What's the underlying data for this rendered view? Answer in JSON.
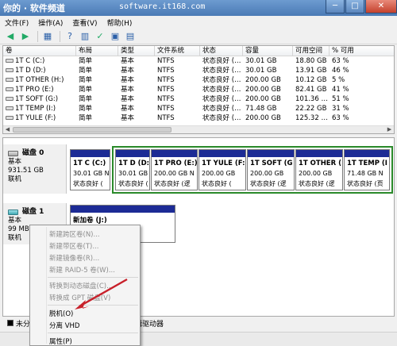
{
  "watermark": {
    "cn": "你的 · 软件频道",
    "url": "software.it168.com"
  },
  "window_buttons": {
    "minimize": "─",
    "maximize": "□",
    "close": "✕"
  },
  "menu": [
    "文件(F)",
    "操作(A)",
    "查看(V)",
    "帮助(H)"
  ],
  "toolbar_icons": [
    "back-arrow-icon",
    "forward-arrow-icon",
    "grid-icon",
    "help-icon",
    "help-book-icon",
    "refresh-icon",
    "properties-icon",
    "view-icon"
  ],
  "table": {
    "columns": [
      "卷",
      "布局",
      "类型",
      "文件系统",
      "状态",
      "容量",
      "可用空间",
      "% 可用"
    ],
    "rows": [
      [
        "1T C (C:)",
        "简单",
        "基本",
        "NTFS",
        "状态良好 (…",
        "30.01 GB",
        "18.80 GB",
        "63 %"
      ],
      [
        "1T D (D:)",
        "简单",
        "基本",
        "NTFS",
        "状态良好 (…",
        "30.01 GB",
        "13.91 GB",
        "46 %"
      ],
      [
        "1T OTHER (H:)",
        "简单",
        "基本",
        "NTFS",
        "状态良好 (…",
        "200.00 GB",
        "10.12 GB",
        "5 %"
      ],
      [
        "1T PRO (E:)",
        "简单",
        "基本",
        "NTFS",
        "状态良好 (…",
        "200.00 GB",
        "82.41 GB",
        "41 %"
      ],
      [
        "1T SOFT (G:)",
        "简单",
        "基本",
        "NTFS",
        "状态良好 (…",
        "200.00 GB",
        "101.36 …",
        "51 %"
      ],
      [
        "1T TEMP (I:)",
        "简单",
        "基本",
        "NTFS",
        "状态良好 (…",
        "71.48 GB",
        "22.22 GB",
        "31 %"
      ],
      [
        "1T YULE (F:)",
        "简单",
        "基本",
        "NTFS",
        "状态良好 (…",
        "200.00 GB",
        "125.32 …",
        "63 %"
      ]
    ]
  },
  "disk0": {
    "name": "磁盘 0",
    "type": "基本",
    "size": "931.51 GB",
    "status": "联机",
    "partitions": [
      {
        "title": "1T C (C:)",
        "size": "30.01 GB N",
        "status": "状态良好 ("
      },
      {
        "title": "1T D (D:",
        "size": "30.01 GB",
        "status": "状态良好 ("
      },
      {
        "title": "1T PRO (E:)",
        "size": "200.00 GB N",
        "status": "状态良好 (逻"
      },
      {
        "title": "1T YULE (F:",
        "size": "200.00 GB",
        "status": "状态良好 ("
      },
      {
        "title": "1T SOFT (G",
        "size": "200.00 GB",
        "status": "状态良好 (逻"
      },
      {
        "title": "1T OTHER (",
        "size": "200.00 GB",
        "status": "状态良好 (逻"
      },
      {
        "title": "1T TEMP (I",
        "size": "71.48 GB N",
        "status": "状态良好 (页"
      }
    ]
  },
  "disk1": {
    "name": "磁盘 1",
    "type": "基本",
    "size": "99 MB",
    "status": "联机",
    "partition": {
      "title": "新加卷 (J:)"
    }
  },
  "context_menu": {
    "items": [
      {
        "label": "新建跨区卷(N)...",
        "enabled": false
      },
      {
        "label": "新建带区卷(T)...",
        "enabled": false
      },
      {
        "label": "新建镜像卷(R)...",
        "enabled": false
      },
      {
        "label": "新建 RAID-5 卷(W)...",
        "enabled": false
      },
      {
        "label": "转换到动态磁盘(C)...",
        "enabled": false
      },
      {
        "label": "转换成 GPT 磁盘(V)",
        "enabled": false
      },
      {
        "label": "脱机(O)",
        "enabled": true
      },
      {
        "label": "分离 VHD",
        "enabled": true
      },
      {
        "label": "属性(P)",
        "enabled": true
      }
    ]
  },
  "legend": {
    "unallocated": "未分",
    "logical": "逻辑驱动器"
  },
  "colors": {
    "primary_partition": "#1c2b95",
    "logical_drive_frame": "#2a8a2a",
    "arrow": "#c8202a"
  }
}
